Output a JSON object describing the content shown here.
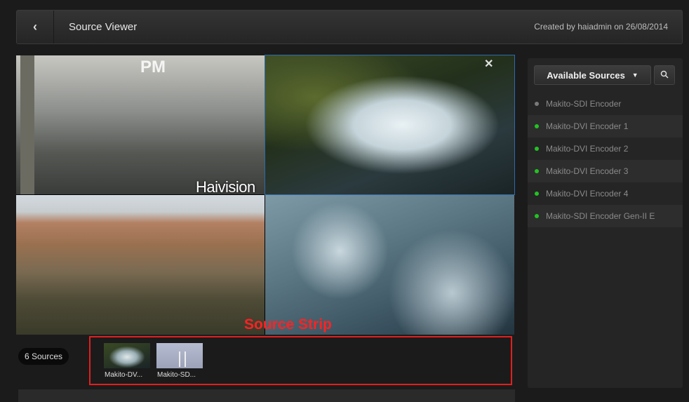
{
  "header": {
    "back_icon": "chevron-left-icon",
    "title": "Source Viewer",
    "created": "Created by haiadmin on 26/08/2014"
  },
  "grid": {
    "watermark": "Haivision",
    "sign_text": "PM",
    "close_symbol": "✕"
  },
  "annotation": {
    "label": "Source Strip",
    "color": "#e21f1f"
  },
  "strip": {
    "count_label": "6 Sources",
    "thumbnails": [
      {
        "label": "Makito-DV..."
      },
      {
        "label": "Makito-SD..."
      }
    ]
  },
  "sidebar": {
    "available_label": "Available Sources",
    "search_icon": "search-icon",
    "sources": [
      {
        "name": "Makito-SDI Encoder",
        "status_color": "#7a7a7a"
      },
      {
        "name": "Makito-DVI Encoder 1",
        "status_color": "#22c322"
      },
      {
        "name": "Makito-DVI Encoder 2",
        "status_color": "#22c322"
      },
      {
        "name": "Makito-DVI Encoder 3",
        "status_color": "#22c322"
      },
      {
        "name": "Makito-DVI Encoder 4",
        "status_color": "#22c322"
      },
      {
        "name": "Makito-SDI Encoder Gen-II E",
        "status_color": "#22c322"
      }
    ]
  }
}
